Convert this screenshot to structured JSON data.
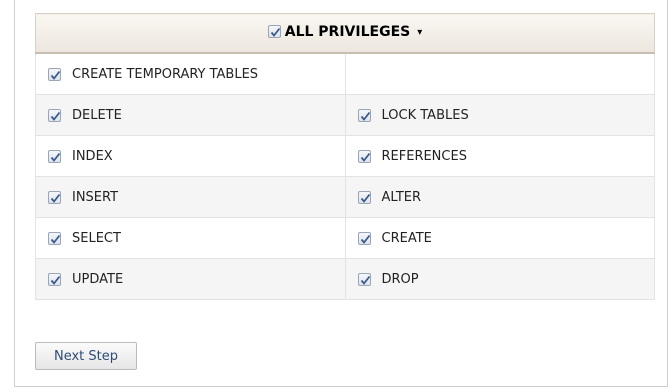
{
  "header": {
    "label": "ALL PRIVILEGES",
    "checked": true,
    "caret": "▾"
  },
  "rows": [
    {
      "left": "CREATE TEMPORARY TABLES",
      "right": ""
    },
    {
      "left": "DELETE",
      "right": "LOCK TABLES"
    },
    {
      "left": "INDEX",
      "right": "REFERENCES"
    },
    {
      "left": "INSERT",
      "right": "ALTER"
    },
    {
      "left": "SELECT",
      "right": "CREATE"
    },
    {
      "left": "UPDATE",
      "right": "DROP"
    }
  ],
  "button": {
    "label": "Next Step"
  },
  "icons": {
    "checkbox": "checkbox-checked-icon",
    "caret": "caret-down-icon"
  },
  "colors": {
    "check": "#3a5a8c",
    "header_bg": "#ece6dd",
    "button_text": "#2f4c73"
  }
}
